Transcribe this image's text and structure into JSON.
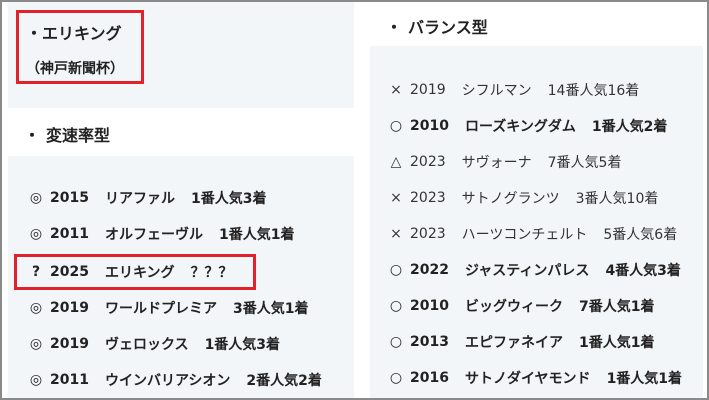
{
  "left": {
    "section1": {
      "bullet": "・",
      "title": "エリキング",
      "subtitle": "（神戸新聞杯）"
    },
    "section2": {
      "bullet": "・",
      "title": "変速率型"
    },
    "rows": [
      {
        "mark": "◎",
        "year": "2015",
        "name": "リアファル",
        "result": "1番人気3着"
      },
      {
        "mark": "◎",
        "year": "2011",
        "name": "オルフェーヴル",
        "result": "1番人気1着"
      },
      {
        "mark": "?",
        "year": "2025",
        "name": "エリキング",
        "result": "？？？"
      },
      {
        "mark": "◎",
        "year": "2019",
        "name": "ワールドプレミア",
        "result": "3番人気1着"
      },
      {
        "mark": "◎",
        "year": "2019",
        "name": "ヴェロックス",
        "result": "1番人気3着"
      },
      {
        "mark": "◎",
        "year": "2011",
        "name": "ウインバリアシオン",
        "result": "2番人気2着"
      }
    ]
  },
  "right": {
    "section": {
      "bullet": "・",
      "title": "バランス型"
    },
    "rows": [
      {
        "mark": "×",
        "year": "2019",
        "name": "シフルマン",
        "result": "14番人気16着",
        "style": "norm"
      },
      {
        "mark": "○",
        "year": "2010",
        "name": "ローズキングダム",
        "result": "1番人気2着",
        "style": "bold"
      },
      {
        "mark": "△",
        "year": "2023",
        "name": "サヴォーナ",
        "result": "7番人気5着",
        "style": "norm"
      },
      {
        "mark": "×",
        "year": "2023",
        "name": "サトノグランツ",
        "result": "3番人気10着",
        "style": "norm"
      },
      {
        "mark": "×",
        "year": "2023",
        "name": "ハーツコンチェルト",
        "result": "5番人気6着",
        "style": "norm"
      },
      {
        "mark": "○",
        "year": "2022",
        "name": "ジャスティンパレス",
        "result": "4番人気3着",
        "style": "bold"
      },
      {
        "mark": "○",
        "year": "2010",
        "name": "ビッグウィーク",
        "result": "7番人気1着",
        "style": "bold"
      },
      {
        "mark": "○",
        "year": "2013",
        "name": "エピファネイア",
        "result": "1番人気1着",
        "style": "bold"
      },
      {
        "mark": "○",
        "year": "2016",
        "name": "サトノダイヤモンド",
        "result": "1番人気1着",
        "style": "bold"
      }
    ]
  },
  "colors": {
    "highlight": "#e0222a",
    "band": "#f3f6f8",
    "frame": "#8a8a8a"
  }
}
